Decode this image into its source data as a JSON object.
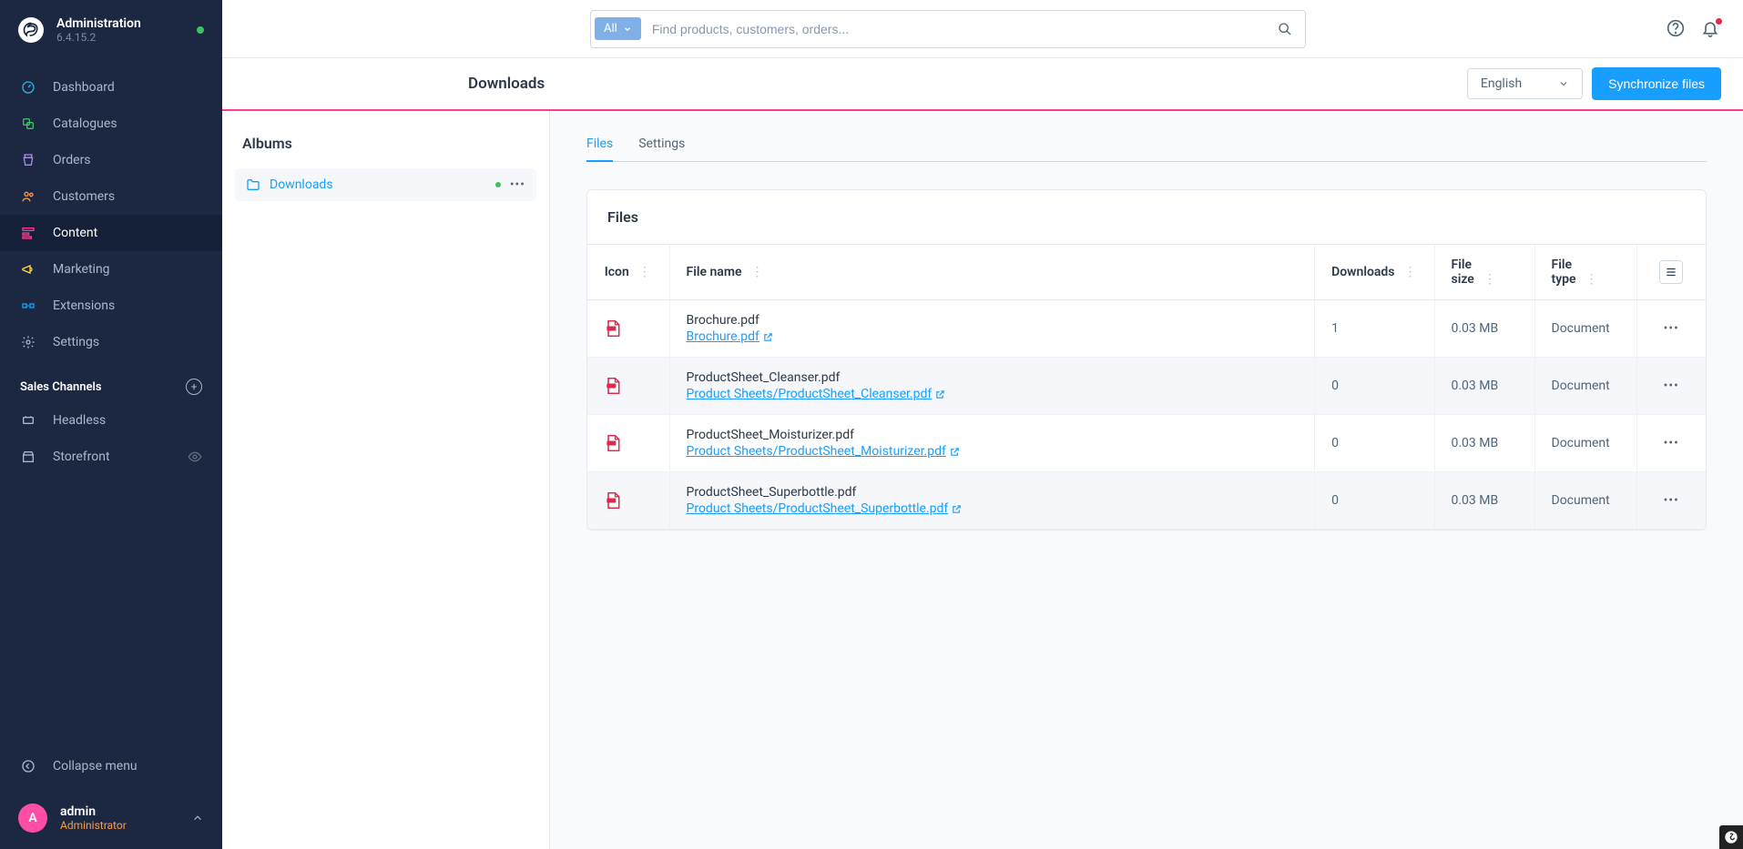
{
  "sidebar": {
    "title": "Administration",
    "version": "6.4.15.2",
    "nav": [
      {
        "label": "Dashboard",
        "icon": "dashboard"
      },
      {
        "label": "Catalogues",
        "icon": "catalogues"
      },
      {
        "label": "Orders",
        "icon": "orders"
      },
      {
        "label": "Customers",
        "icon": "customers"
      },
      {
        "label": "Content",
        "icon": "content"
      },
      {
        "label": "Marketing",
        "icon": "marketing"
      },
      {
        "label": "Extensions",
        "icon": "extensions"
      },
      {
        "label": "Settings",
        "icon": "settings"
      }
    ],
    "salesTitle": "Sales Channels",
    "sales": [
      {
        "label": "Headless",
        "icon": "headless"
      },
      {
        "label": "Storefront",
        "icon": "storefront"
      }
    ],
    "collapse": "Collapse menu",
    "user": {
      "initial": "A",
      "name": "admin",
      "role": "Administrator"
    }
  },
  "search": {
    "all": "All",
    "placeholder": "Find products, customers, orders..."
  },
  "page": {
    "title": "Downloads",
    "language": "English",
    "syncBtn": "Synchronize files"
  },
  "albums": {
    "title": "Albums",
    "items": [
      {
        "name": "Downloads"
      }
    ]
  },
  "tabs": [
    {
      "label": "Files",
      "active": true
    },
    {
      "label": "Settings",
      "active": false
    }
  ],
  "card": {
    "title": "Files"
  },
  "table": {
    "headers": {
      "icon": "Icon",
      "name": "File name",
      "downloads": "Downloads",
      "size": "File size",
      "type": "File type"
    },
    "rows": [
      {
        "name": "Brochure.pdf",
        "link": "Brochure.pdf",
        "downloads": "1",
        "size": "0.03 MB",
        "type": "Document"
      },
      {
        "name": "ProductSheet_Cleanser.pdf",
        "link": "Product Sheets/ProductSheet_Cleanser.pdf",
        "downloads": "0",
        "size": "0.03 MB",
        "type": "Document"
      },
      {
        "name": "ProductSheet_Moisturizer.pdf",
        "link": "Product Sheets/ProductSheet_Moisturizer.pdf",
        "downloads": "0",
        "size": "0.03 MB",
        "type": "Document"
      },
      {
        "name": "ProductSheet_Superbottle.pdf",
        "link": "Product Sheets/ProductSheet_Superbottle.pdf",
        "downloads": "0",
        "size": "0.03 MB",
        "type": "Document"
      }
    ]
  }
}
